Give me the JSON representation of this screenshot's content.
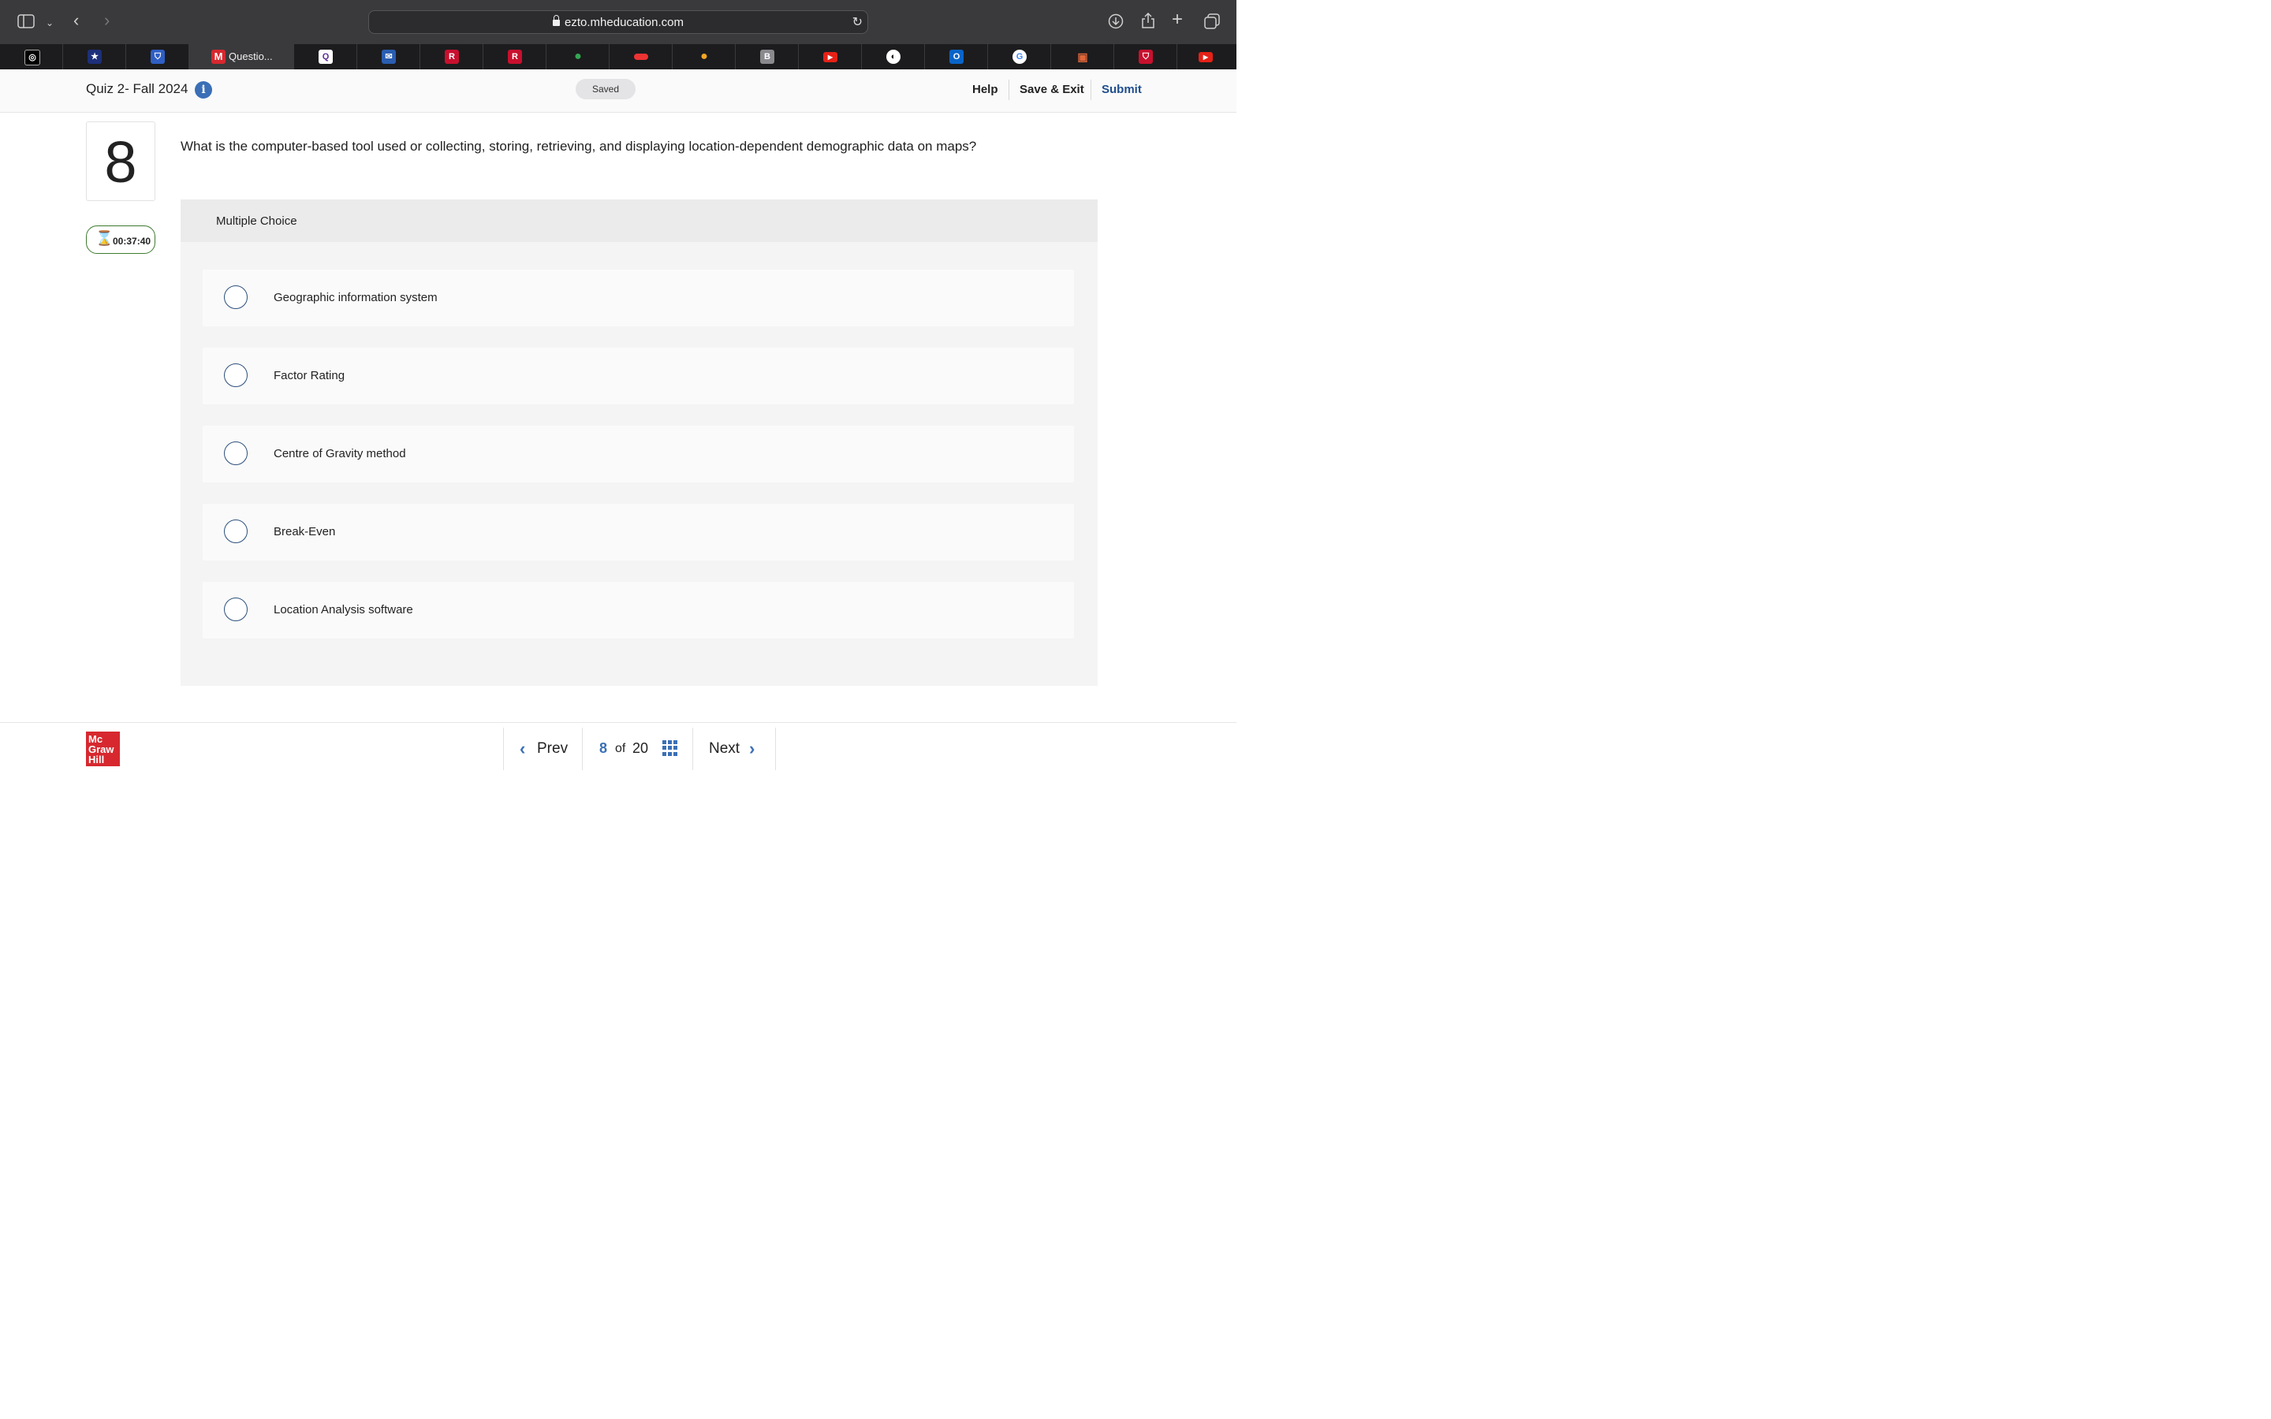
{
  "browser": {
    "url": "ezto.mheducation.com",
    "active_tab_title": "Questio...",
    "favicons": [
      "openai-icon",
      "star-shield-icon",
      "shield-icon",
      "mcgraw-hill-icon",
      "quizlet-icon",
      "mail-icon",
      "r-icon",
      "r-icon",
      "maps-pin-icon",
      "toggle-icon",
      "location-pin-icon",
      "b-icon",
      "youtube-icon",
      "clock-icon",
      "outlook-icon",
      "google-icon",
      "bag-icon",
      "shield-red-icon",
      "youtube-icon"
    ]
  },
  "header": {
    "quiz_title": "Quiz 2- Fall 2024",
    "saved_label": "Saved",
    "help_label": "Help",
    "save_exit_label": "Save & Exit",
    "submit_label": "Submit"
  },
  "question": {
    "number": "8",
    "timer": "00:37:40",
    "prompt": "What is the computer-based tool used or collecting, storing, retrieving, and displaying location-dependent demographic data on maps?",
    "type_label": "Multiple Choice",
    "options": [
      "Geographic information system",
      "Factor Rating",
      "Centre of Gravity method",
      "Break-Even",
      "Location Analysis software"
    ]
  },
  "footer": {
    "logo_lines": [
      "Mc",
      "Graw",
      "Hill"
    ],
    "prev_label": "Prev",
    "current_page": "8",
    "of_label": "of",
    "total_pages": "20",
    "next_label": "Next"
  },
  "colors": {
    "accent": "#3b6fb6",
    "timer_border": "#3d7a2e",
    "logo_red": "#d7282f"
  }
}
